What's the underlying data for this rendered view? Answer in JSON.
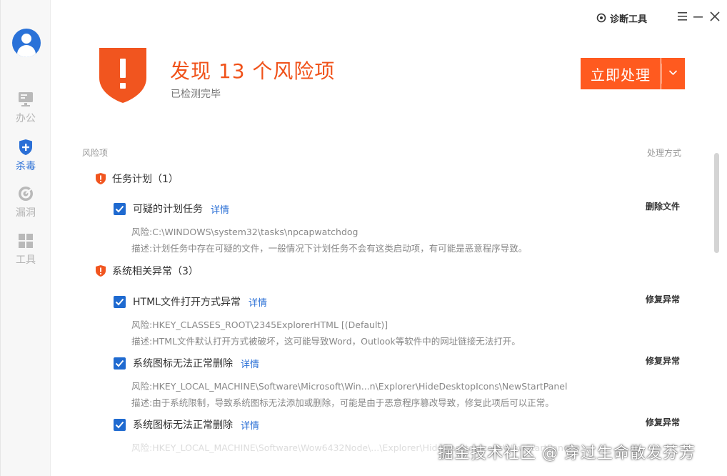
{
  "sidebar": {
    "items": [
      {
        "label": "办公",
        "icon": "monitor-icon"
      },
      {
        "label": "杀毒",
        "icon": "shield-plus-icon",
        "active": true
      },
      {
        "label": "漏洞",
        "icon": "radar-icon"
      },
      {
        "label": "工具",
        "icon": "grid-icon"
      }
    ]
  },
  "titlebar": {
    "tool_label": "诊断工具"
  },
  "header": {
    "headline": "发现 13 个风险项",
    "subline": "已检测完毕",
    "action_label": "立即处理"
  },
  "list": {
    "col_left": "风险项",
    "col_right": "处理方式",
    "groups": [
      {
        "label": "任务计划（1）",
        "items": [
          {
            "title": "可疑的计划任务",
            "link": "详情",
            "action": "删除文件",
            "risk": "风险:C:\\WINDOWS\\system32\\tasks\\npcapwatchdog",
            "desc": "描述:计划任务中存在可疑的文件，一般情况下计划任务不会有这类启动项，有可能是恶意程序导致。"
          }
        ]
      },
      {
        "label": "系统相关异常（3）",
        "items": [
          {
            "title": "HTML文件打开方式异常",
            "link": "详情",
            "action": "修复异常",
            "risk": "风险:HKEY_CLASSES_ROOT\\2345ExplorerHTML [(Default)]",
            "desc": "描述:HTML文件默认打开方式被破坏，这可能导致Word，Outlook等软件中的网址链接无法打开。"
          },
          {
            "title": "系统图标无法正常删除",
            "link": "详情",
            "action": "修复异常",
            "risk": "风险:HKEY_LOCAL_MACHINE\\Software\\Microsoft\\Win...n\\Explorer\\HideDesktopIcons\\NewStartPanel",
            "desc": "描述:由于系统限制，导致系统图标无法添加或删除，可能是由于恶意程序篡改导致，修复此项后可以正常。"
          },
          {
            "title": "系统图标无法正常删除",
            "link": "详情",
            "action": "修复异常",
            "risk": "风险:HKEY_LOCAL_MACHINE\\Software\\Wow6432Node\\...\\Explorer\\HideDesktopIcons\\NewStartPanel"
          }
        ]
      }
    ]
  },
  "watermark": "掘金技术社区 @ 穿过生命散发芬芳",
  "colors": {
    "accent": "#ff5a1f",
    "headline": "#f0521a",
    "checkbox": "#1f6ad0",
    "link": "#2a6fd6"
  }
}
